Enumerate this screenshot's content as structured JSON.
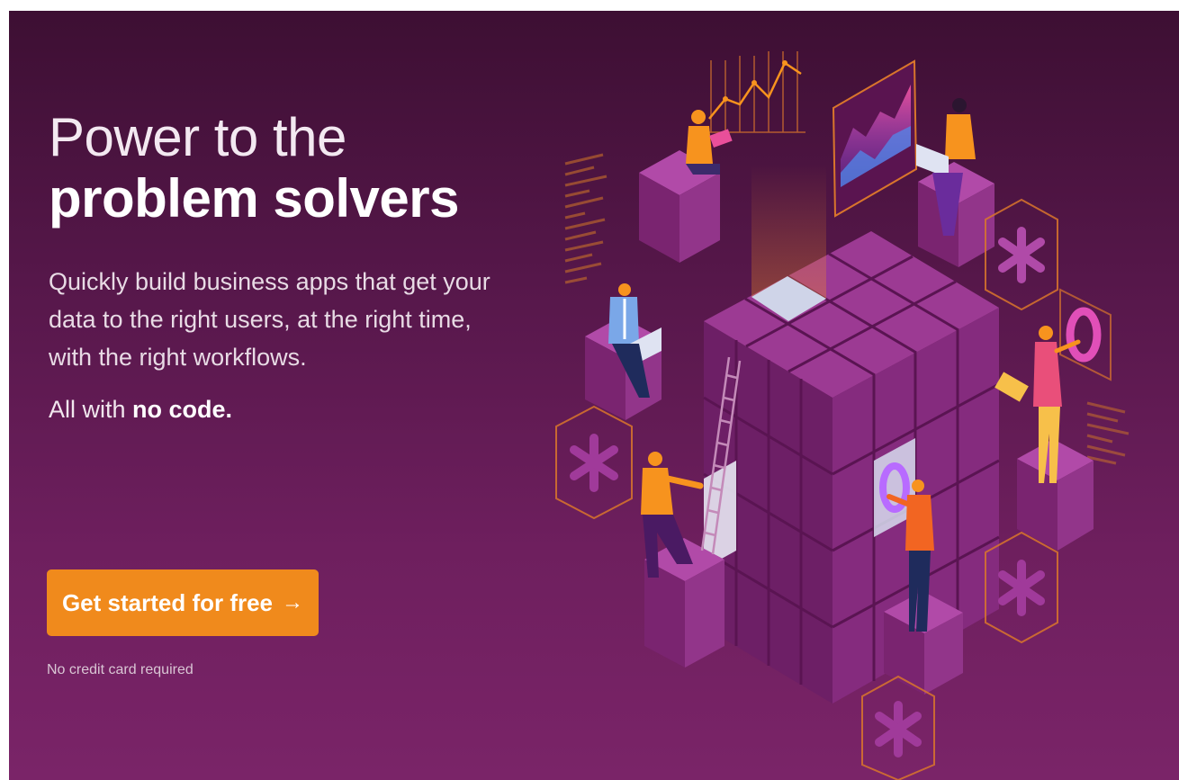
{
  "hero": {
    "headline_light": "Power to the",
    "headline_bold": "problem solvers",
    "subcopy": "Quickly build business apps that get your data to the right users, at the right time, with the right workflows.",
    "no_code_prefix": "All with",
    "no_code_bold": "no code.",
    "cta_label": "Get started for free",
    "cta_arrow": "→",
    "note": "No credit card required"
  },
  "colors": {
    "background_top": "#3d0f33",
    "background_bottom": "#7a2468",
    "cta": "#f08a1c",
    "cube_top": "#9c3a93",
    "cube_left": "#6d1f66",
    "cube_right": "#852b7e",
    "accent_orange": "#f7931e"
  },
  "illustration": {
    "icons": [
      "isometric-cube-icon",
      "person-laptop-icon",
      "line-chart-icon",
      "area-chart-icon",
      "ladder-icon",
      "asterisk-hexagon-icon",
      "ring-icon",
      "code-lines-icon"
    ]
  }
}
